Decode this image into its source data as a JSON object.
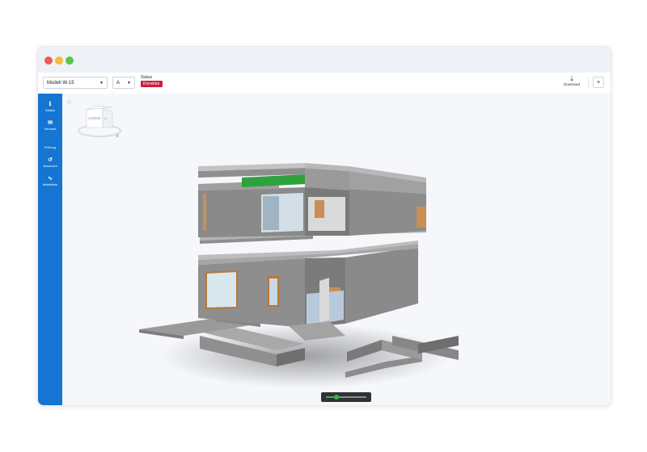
{
  "window": {
    "traffic_lights": [
      "close",
      "minimize",
      "maximize"
    ]
  },
  "toolbar": {
    "model_select": {
      "value": "Modell W-15"
    },
    "variant_select": {
      "value": "A"
    },
    "status": {
      "label": "Status",
      "badge": "Korrektur",
      "badge_color": "#c8203f"
    },
    "download": {
      "label": "Download"
    },
    "close_icon": "×"
  },
  "sidebar": {
    "color": "#1475d3",
    "items": [
      {
        "icon": "info-icon",
        "glyph": "ℹ",
        "label": "Details"
      },
      {
        "icon": "mail-icon",
        "glyph": "✉",
        "label": "Versand"
      },
      {
        "icon": "user-check-icon",
        "glyph": "👤",
        "label": "Prüfung"
      },
      {
        "icon": "history-icon",
        "glyph": "↺",
        "label": "Versionen"
      },
      {
        "icon": "activity-icon",
        "glyph": "∿",
        "label": "Aktivitäten"
      }
    ]
  },
  "viewer": {
    "home_icon": "⌂",
    "view_cube": {
      "front": "VORNE",
      "right": "LI"
    },
    "zoom_slider": {
      "value": 0.25,
      "accent": "#39b54a"
    }
  }
}
